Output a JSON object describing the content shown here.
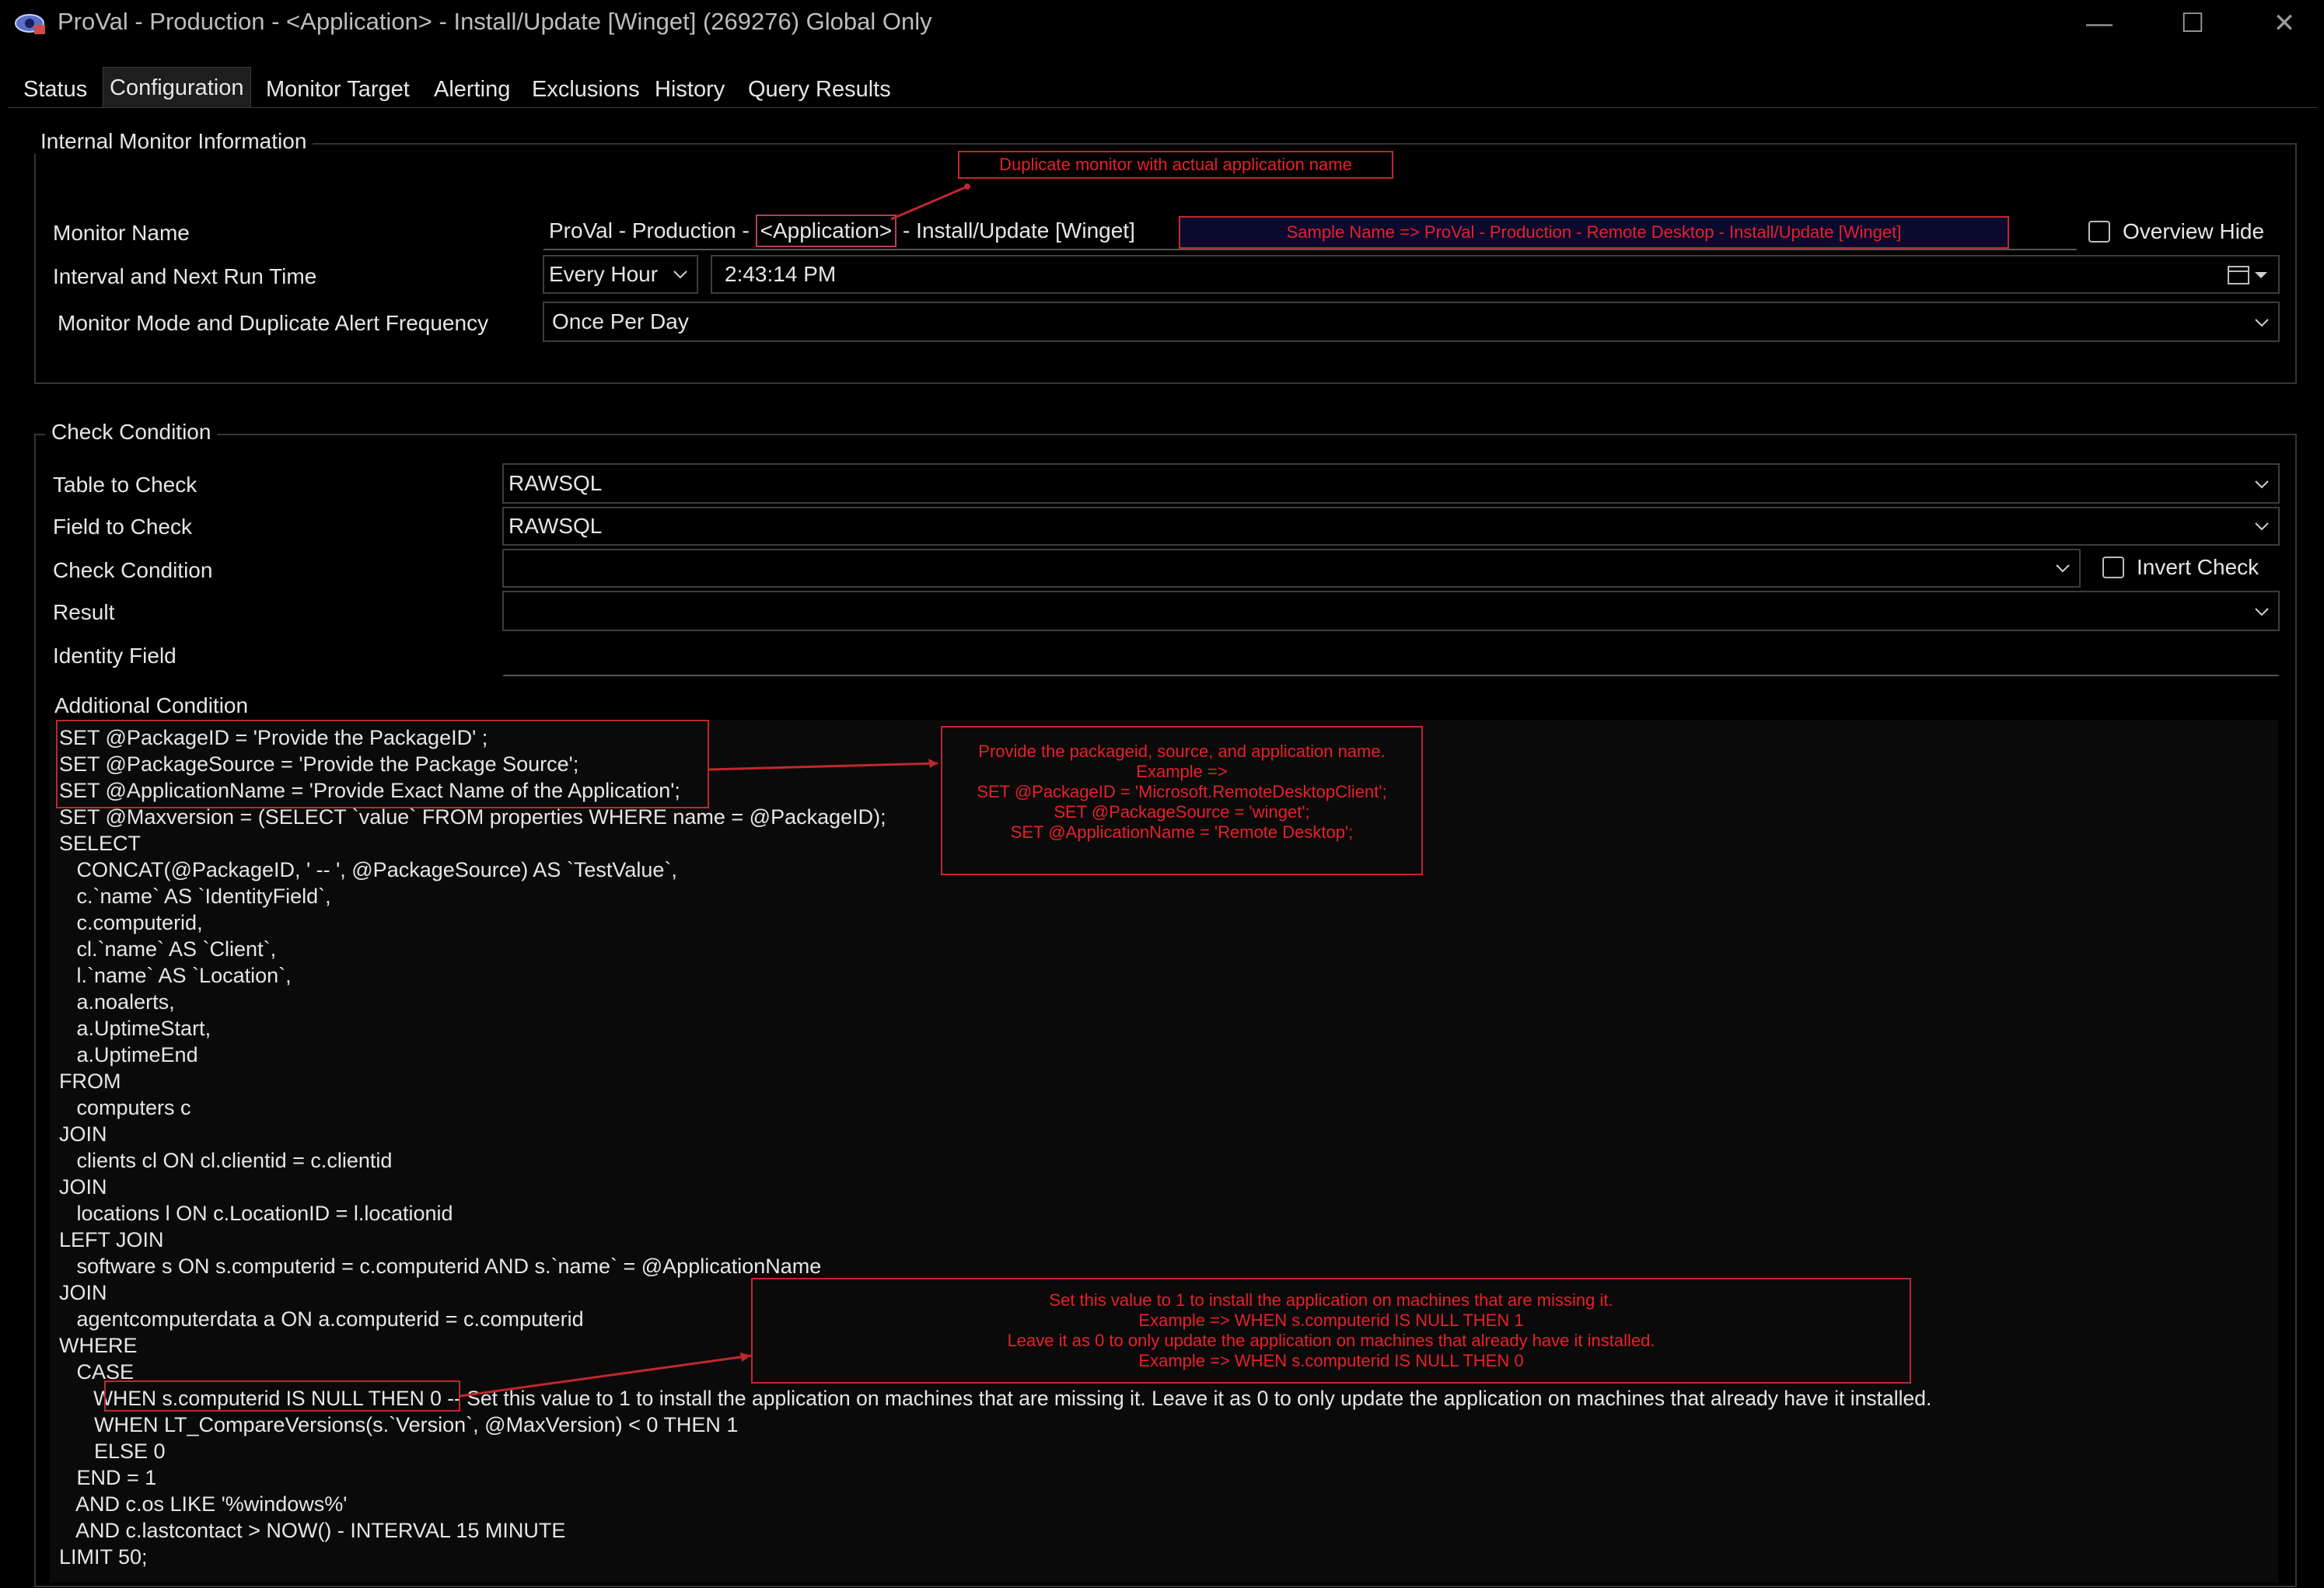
{
  "window": {
    "title": "ProVal - Production - <Application> - Install/Update [Winget] (269276) Global Only",
    "minimize_label": "—",
    "maximize_label": "☐",
    "close_label": "✕"
  },
  "tabs": [
    {
      "label": "Status"
    },
    {
      "label": "Configuration",
      "active": true
    },
    {
      "label": "Monitor Target"
    },
    {
      "label": "Alerting"
    },
    {
      "label": "Exclusions"
    },
    {
      "label": "History"
    },
    {
      "label": "Query Results"
    }
  ],
  "internal_info": {
    "group_title": "Internal Monitor Information",
    "monitor_name_label": "Monitor Name",
    "monitor_name_prefix": "ProVal - Production - ",
    "monitor_name_highlight": "<Application>",
    "monitor_name_suffix": " - Install/Update [Winget]",
    "interval_label": "Interval and Next Run Time",
    "interval_value": "Every Hour",
    "next_run_time": "2:43:14 PM",
    "mode_label": "Monitor Mode and Duplicate Alert Frequency",
    "mode_value": "Once Per Day",
    "overview_hide_label": "Overview Hide",
    "overview_hide_checked": false
  },
  "check_condition": {
    "group_title": "Check Condition",
    "table_label": "Table to Check",
    "table_value": "RAWSQL",
    "field_label": "Field to Check",
    "field_value": "RAWSQL",
    "condition_label": "Check Condition",
    "condition_value": "",
    "invert_label": "Invert Check",
    "invert_checked": false,
    "result_label": "Result",
    "result_value": "",
    "identity_label": "Identity Field",
    "identity_value": "",
    "additional_label": "Additional Condition"
  },
  "annotations": {
    "duplicate_note": "Duplicate monitor with actual application name",
    "sample_name": "Sample Name => ProVal - Production - Remote Desktop - Install/Update [Winget]",
    "provide_note": [
      "Provide the packageid, source, and application name.",
      "Example =>",
      "SET @PackageID = 'Microsoft.RemoteDesktopClient';",
      "SET @PackageSource = 'winget';",
      "SET @ApplicationName = 'Remote Desktop';"
    ],
    "install_note": [
      "Set this value to 1 to install the application on machines that are missing it.",
      "Example => WHEN s.computerid IS NULL THEN 1",
      "Leave it as 0 to only update the application on machines that already have it installed.",
      "Example => WHEN s.computerid IS NULL THEN 0"
    ]
  },
  "code_lines": [
    "SET @PackageID = 'Provide the PackageID' ;",
    "SET @PackageSource = 'Provide the Package Source';",
    "SET @ApplicationName = 'Provide Exact Name of the Application';",
    "SET @Maxversion = (SELECT `value` FROM properties WHERE name = @PackageID);",
    "SELECT",
    "   CONCAT(@PackageID, ' -- ', @PackageSource) AS `TestValue`,",
    "   c.`name` AS `IdentityField`,",
    "   c.computerid,",
    "   cl.`name` AS `Client`,",
    "   l.`name` AS `Location`,",
    "   a.noalerts,",
    "   a.UptimeStart,",
    "   a.UptimeEnd",
    "FROM",
    "   computers c",
    "JOIN",
    "   clients cl ON cl.clientid = c.clientid",
    "JOIN",
    "   locations l ON c.LocationID = l.locationid",
    "LEFT JOIN",
    "   software s ON s.computerid = c.computerid AND s.`name` = @ApplicationName",
    "JOIN",
    "   agentcomputerdata a ON a.computerid = c.computerid",
    "WHERE",
    "   CASE",
    "      WHEN s.computerid IS NULL THEN 0 -- Set this value to 1 to install the application on machines that are missing it. Leave it as 0 to only update the application on machines that already have it installed.",
    "      WHEN LT_CompareVersions(s.`Version`, @MaxVersion) < 0 THEN 1",
    "      ELSE 0",
    "   END = 1",
    "   AND c.os LIKE '%windows%'",
    "   AND c.lastcontact > NOW() - INTERVAL 15 MINUTE",
    "LIMIT 50;"
  ],
  "colors": {
    "annotation": "#e8202a",
    "annotation_border": "#c0272d",
    "background": "#000000",
    "text": "#e6e6e6"
  }
}
